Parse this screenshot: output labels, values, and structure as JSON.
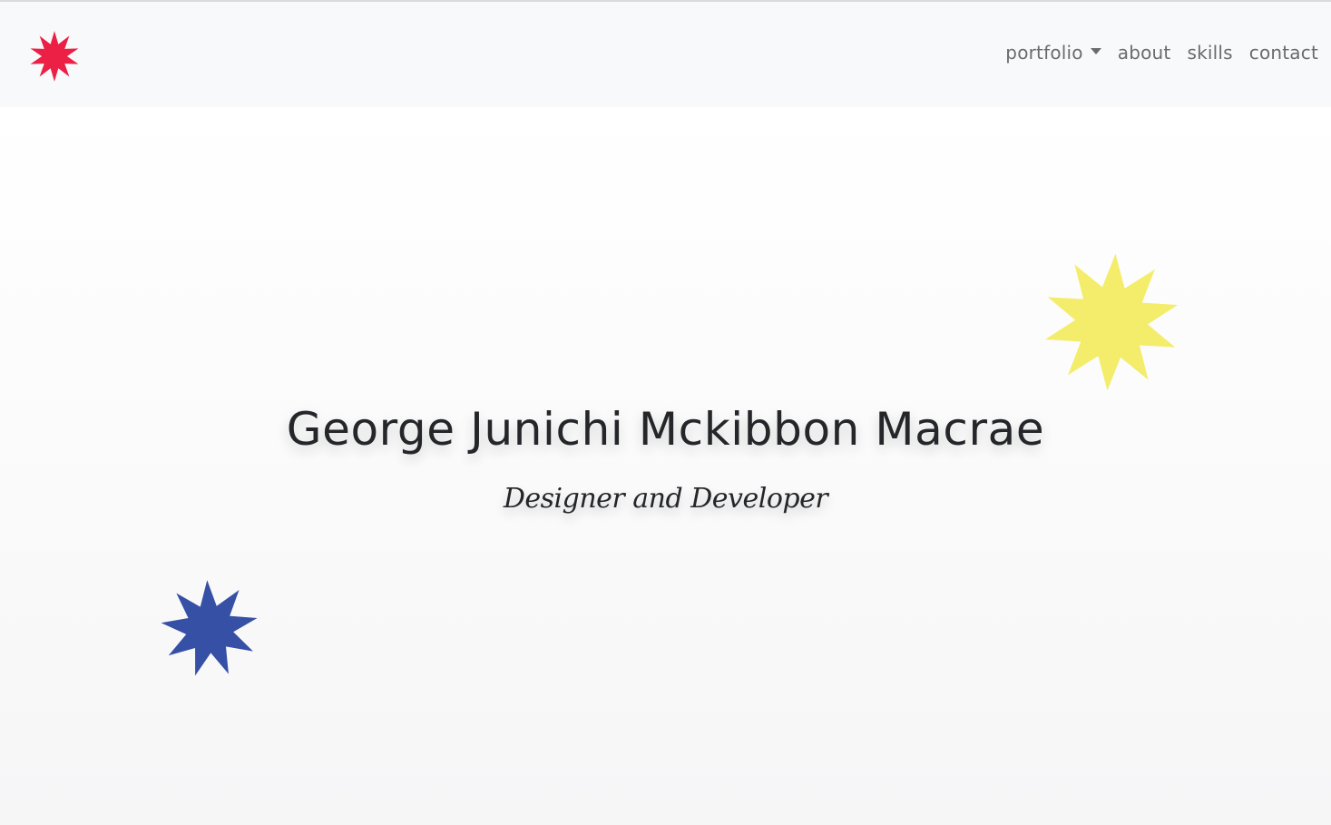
{
  "colors": {
    "logo_star": "#ec1f44",
    "yellow_star": "#f4ed6b",
    "blue_star": "#3650a6",
    "nav_text": "#6a6b6d",
    "title_text": "#24262a"
  },
  "header": {
    "logo_icon": "red-starburst-icon",
    "nav": {
      "portfolio": "portfolio",
      "about": "about",
      "skills": "skills",
      "contact": "contact"
    }
  },
  "hero": {
    "title": "George Junichi Mckibbon Macrae",
    "subtitle": "Designer and Developer",
    "decorations": [
      "yellow-starburst-icon",
      "blue-starburst-icon"
    ]
  }
}
